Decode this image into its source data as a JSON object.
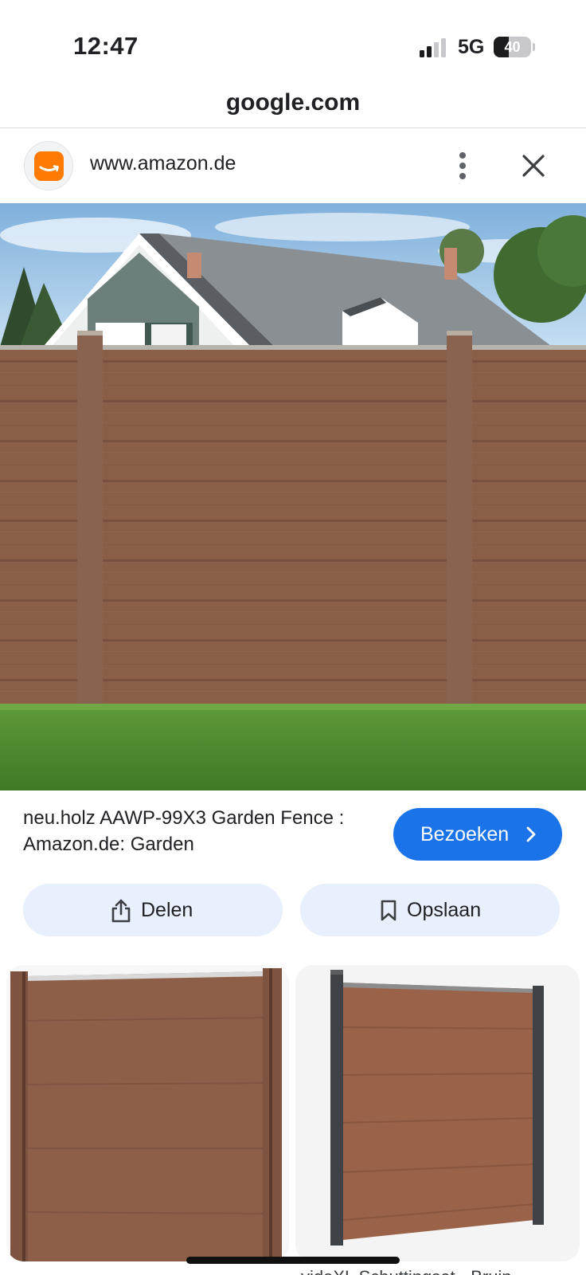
{
  "status_bar": {
    "time": "12:47",
    "network": "5G",
    "battery_level": "40",
    "signal_bars_active": 2,
    "signal_bars_total": 4
  },
  "browser": {
    "url": "google.com"
  },
  "source": {
    "domain": "www.amazon.de",
    "favicon": "amazon-smile-icon",
    "menu_icon": "more-vertical-icon",
    "close_icon": "close-icon"
  },
  "result": {
    "title": "neu.holz AAWP-99X3 Garden Fence : Amazon.de: Garden",
    "visit_label": "Bezoeken",
    "share_label": "Delen",
    "save_label": "Opslaan"
  },
  "related": {
    "caption": "vidaXL Schuttingset - Bruin"
  },
  "colors": {
    "accent": "#1a73e8",
    "action_bg": "#e8f0fe",
    "amazon_orange": "#ff7a00",
    "fence_brown": "#8b5e48"
  }
}
